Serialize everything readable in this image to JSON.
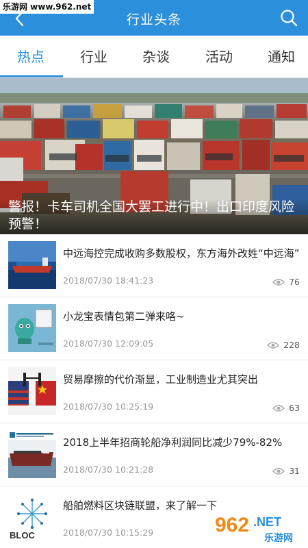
{
  "watermark": "乐游网 www.962.net",
  "header": {
    "title": "行业头条"
  },
  "tabs": [
    {
      "label": "热点"
    },
    {
      "label": "行业"
    },
    {
      "label": "杂谈"
    },
    {
      "label": "活动"
    },
    {
      "label": "通知"
    }
  ],
  "active_tab": 0,
  "banner": {
    "title": "警报！卡车司机全国大罢工进行中！出口印度风险预警！"
  },
  "news": [
    {
      "title": "中远海控完成收购多数股权，东方海外改姓“中远海”",
      "time": "2018/07/30 18:41:23",
      "views": "76"
    },
    {
      "title": "小龙宝表情包第二弹来咯~",
      "time": "2018/07/30 12:09:05",
      "views": "228"
    },
    {
      "title": "贸易摩擦的代价渐显，工业制造业尤其突出",
      "time": "2018/07/30 10:25:19",
      "views": "63"
    },
    {
      "title": "2018上半年招商轮船净利润同比减少79%-82%",
      "time": "2018/07/30 10:21:28",
      "views": "31"
    },
    {
      "title": "船舶燃料区块链联盟，来了解一下",
      "time": "2018/07/30 10:15:29",
      "views": ""
    }
  ],
  "thumb_texts": {
    "bloc": "BLOC"
  },
  "corner_logo": {
    "number": "962",
    "suffix": ".NET",
    "name": "乐游网"
  }
}
